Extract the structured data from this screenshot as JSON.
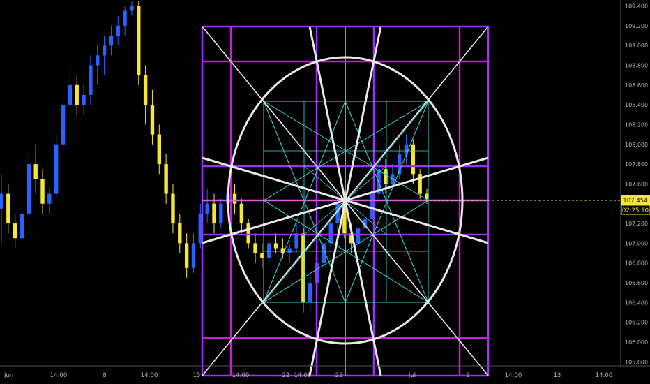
{
  "chart_data": {
    "type": "candlestick",
    "title": "",
    "xlabel": "",
    "ylabel": "",
    "ylim": [
      105.76,
      109.46
    ],
    "grid": false,
    "y_ticks": [
      "109.400",
      "109.200",
      "109.000",
      "108.800",
      "108.600",
      "108.400",
      "108.200",
      "108.000",
      "107.800",
      "107.600",
      "107.400",
      "107.200",
      "107.000",
      "106.800",
      "106.600",
      "106.400",
      "106.200",
      "106.000",
      "105.800"
    ],
    "x_ticks": [
      "Jun",
      "14:00",
      "8",
      "14:00",
      "15",
      "14:00",
      "22",
      "14:00",
      "25",
      "Jul",
      "6",
      "14:00",
      "13",
      "14:00"
    ],
    "price_badge": "107.454",
    "countdown_badge": "02:25:10",
    "series": [
      {
        "values": [
          [
            107.35,
            107.7,
            107.0,
            107.5
          ],
          [
            107.5,
            107.6,
            107.1,
            107.2
          ],
          [
            107.2,
            107.3,
            106.95,
            107.05
          ],
          [
            107.05,
            107.4,
            107.0,
            107.3
          ],
          [
            107.3,
            107.9,
            107.25,
            107.8
          ],
          [
            107.8,
            108.0,
            107.5,
            107.65
          ],
          [
            107.65,
            107.75,
            107.3,
            107.4
          ],
          [
            107.4,
            107.55,
            107.3,
            107.5
          ],
          [
            107.5,
            108.1,
            107.45,
            108.0
          ],
          [
            108.0,
            108.5,
            107.9,
            108.4
          ],
          [
            108.4,
            108.8,
            108.3,
            108.6
          ],
          [
            108.6,
            108.7,
            108.3,
            108.4
          ],
          [
            108.4,
            108.6,
            108.3,
            108.5
          ],
          [
            108.5,
            108.9,
            108.4,
            108.8
          ],
          [
            108.8,
            109.0,
            108.6,
            108.9
          ],
          [
            108.9,
            109.1,
            108.7,
            109.0
          ],
          [
            109.0,
            109.2,
            108.9,
            109.1
          ],
          [
            109.1,
            109.3,
            109.0,
            109.2
          ],
          [
            109.2,
            109.4,
            109.1,
            109.35
          ],
          [
            109.35,
            109.45,
            109.3,
            109.4
          ],
          [
            109.4,
            109.45,
            108.6,
            108.7
          ],
          [
            108.7,
            108.8,
            108.2,
            108.4
          ],
          [
            108.4,
            108.55,
            108.0,
            108.1
          ],
          [
            108.1,
            108.2,
            107.7,
            107.8
          ],
          [
            107.8,
            107.9,
            107.4,
            107.5
          ],
          [
            107.5,
            107.6,
            107.1,
            107.2
          ],
          [
            107.2,
            107.3,
            106.9,
            107.0
          ],
          [
            107.0,
            107.1,
            106.65,
            106.75
          ],
          [
            106.75,
            107.1,
            106.7,
            107.0
          ],
          [
            107.0,
            107.4,
            106.95,
            107.3
          ],
          [
            107.3,
            107.55,
            107.2,
            107.4
          ],
          [
            107.4,
            107.5,
            107.1,
            107.2
          ],
          [
            107.2,
            107.45,
            107.15,
            107.4
          ],
          [
            107.4,
            107.55,
            107.3,
            107.5
          ],
          [
            107.5,
            107.6,
            107.3,
            107.4
          ],
          [
            107.4,
            107.45,
            107.1,
            107.2
          ],
          [
            107.2,
            107.25,
            106.95,
            107.0
          ],
          [
            107.0,
            107.1,
            106.8,
            106.9
          ],
          [
            106.9,
            107.0,
            106.75,
            106.85
          ],
          [
            106.85,
            107.05,
            106.8,
            107.0
          ],
          [
            107.0,
            107.1,
            106.9,
            106.95
          ],
          [
            106.95,
            107.05,
            106.85,
            106.9
          ],
          [
            106.9,
            107.0,
            106.8,
            106.95
          ],
          [
            106.95,
            107.2,
            106.9,
            107.1
          ],
          [
            107.1,
            107.15,
            106.3,
            106.4
          ],
          [
            106.4,
            106.7,
            106.3,
            106.6
          ],
          [
            106.6,
            106.9,
            106.5,
            106.8
          ],
          [
            106.8,
            107.1,
            106.75,
            107.0
          ],
          [
            107.0,
            107.3,
            106.9,
            107.2
          ],
          [
            107.2,
            107.5,
            107.1,
            107.4
          ],
          [
            107.4,
            107.45,
            107.05,
            107.1
          ],
          [
            107.1,
            107.2,
            106.9,
            107.0
          ],
          [
            107.0,
            107.2,
            106.95,
            107.15
          ],
          [
            107.15,
            107.3,
            107.05,
            107.25
          ],
          [
            107.25,
            107.6,
            107.2,
            107.5
          ],
          [
            107.5,
            107.85,
            107.45,
            107.75
          ],
          [
            107.75,
            107.85,
            107.5,
            107.6
          ],
          [
            107.6,
            107.8,
            107.55,
            107.7
          ],
          [
            107.7,
            108.0,
            107.65,
            107.9
          ],
          [
            107.9,
            108.1,
            107.8,
            108.0
          ],
          [
            108.0,
            108.05,
            107.6,
            107.7
          ],
          [
            107.7,
            107.75,
            107.45,
            107.5
          ],
          [
            107.5,
            107.55,
            107.4,
            107.45
          ]
        ]
      }
    ]
  }
}
